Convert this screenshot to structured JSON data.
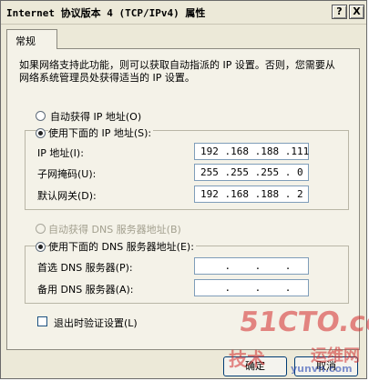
{
  "window": {
    "title": "Internet 协议版本 4 (TCP/IPv4) 属性",
    "help_label": "?",
    "close_label": "X"
  },
  "tabs": [
    {
      "label": "常规"
    }
  ],
  "description": "如果网络支持此功能，则可以获取自动指派的 IP 设置。否则，您需要从网络系统管理员处获得适当的 IP 设置。",
  "ip": {
    "auto_label": "自动获得 IP 地址(O)",
    "manual_label": "使用下面的 IP 地址(S):",
    "address_label": "IP 地址(I):",
    "address_value": "192 .168 .188 .111",
    "mask_label": "子网掩码(U):",
    "mask_value": "255 .255 .255 . 0",
    "gateway_label": "默认网关(D):",
    "gateway_value": "192 .168 .188 . 2"
  },
  "dns": {
    "auto_label": "自动获得 DNS 服务器地址(B)",
    "manual_label": "使用下面的 DNS 服务器地址(E):",
    "preferred_label": "首选 DNS 服务器(P):",
    "preferred_value": "    .    .    .",
    "alternate_label": "备用 DNS 服务器(A):",
    "alternate_value": "    .    .    ."
  },
  "validate_label": "退出时验证设置(L)",
  "buttons": {
    "ok_label": "确定",
    "cancel_label": "取消"
  },
  "watermark": {
    "top": "51CTO.com",
    "bottom_left": "技术",
    "bottom_right": "运维网",
    "url": "yunvn.com"
  }
}
